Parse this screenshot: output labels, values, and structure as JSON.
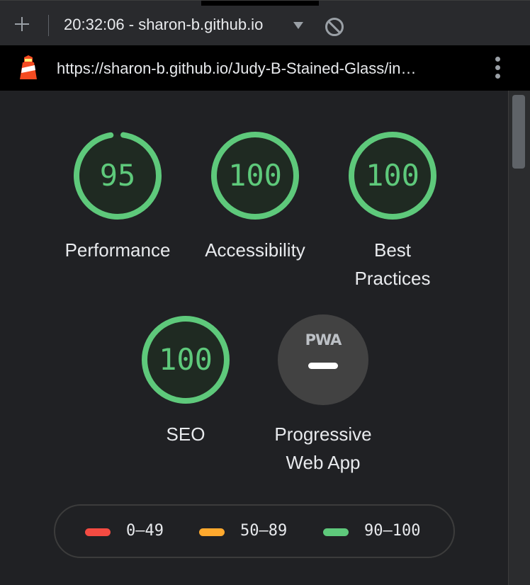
{
  "toolbar": {
    "new_report_icon": "plus-icon",
    "report_title": "20:32:06 - sharon-b.github.io",
    "dropdown_icon": "caret-down-icon",
    "clear_icon": "block-icon"
  },
  "urlbar": {
    "logo_icon": "lighthouse-icon",
    "url": "https://sharon-b.github.io/Judy-B-Stained-Glass/in…",
    "menu_icon": "more-vert-icon"
  },
  "gauges": [
    {
      "label": "Performance",
      "score": 95,
      "display": "95",
      "color": "#5ec97b"
    },
    {
      "label": "Accessibility",
      "score": 100,
      "display": "100",
      "color": "#5ec97b"
    },
    {
      "label_line1": "Best",
      "label_line2": "Practices",
      "score": 100,
      "display": "100",
      "color": "#5ec97b"
    },
    {
      "label": "SEO",
      "score": 100,
      "display": "100",
      "color": "#5ec97b"
    }
  ],
  "pwa": {
    "badge_text": "PWA",
    "label_line1": "Progressive",
    "label_line2": "Web App"
  },
  "legend": [
    {
      "range": "0–49",
      "color": "#f44b42"
    },
    {
      "range": "50–89",
      "color": "#ffa92e"
    },
    {
      "range": "90–100",
      "color": "#5ec97b"
    }
  ]
}
